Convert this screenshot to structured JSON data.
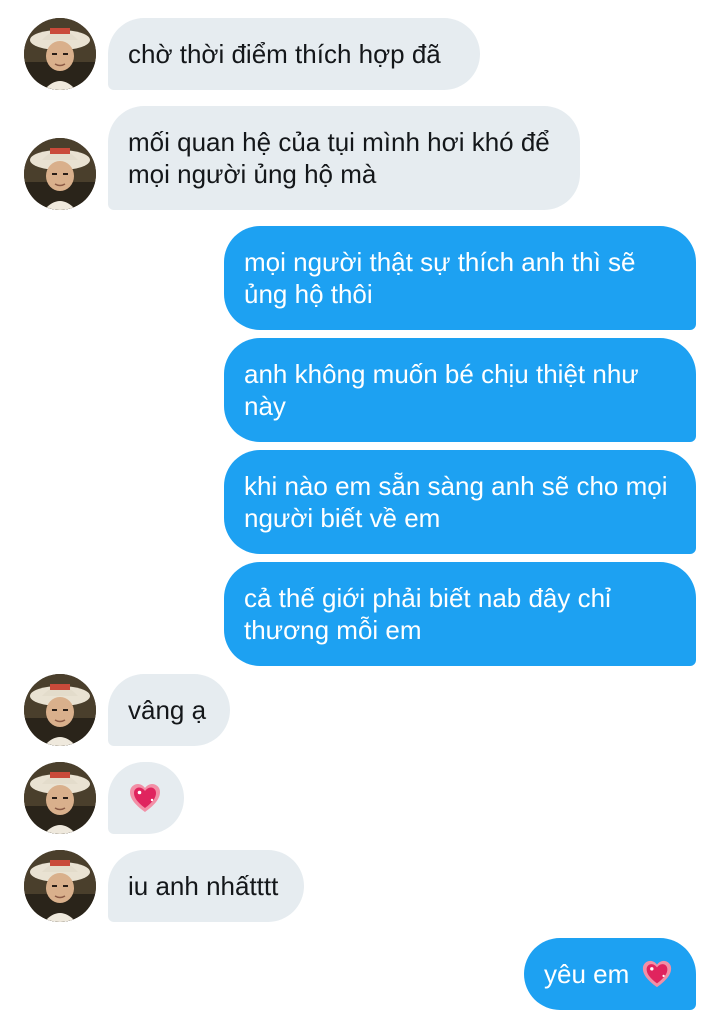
{
  "conversation": {
    "messages": [
      {
        "side": "in",
        "text": "chờ thời điểm thích hợp đã",
        "has_avatar": true
      },
      {
        "side": "in",
        "text": "mối quan hệ của tụi mình hơi khó để mọi người ủng hộ mà",
        "has_avatar": true
      },
      {
        "side": "out",
        "text": "mọi người thật sự thích anh thì sẽ ủng hộ thôi"
      },
      {
        "side": "out",
        "text": "anh không muốn bé chịu thiệt như này"
      },
      {
        "side": "out",
        "text": "khi nào em sẵn sàng anh sẽ cho mọi người biết về em"
      },
      {
        "side": "out",
        "text": "cả thế giới phải biết nab đây chỉ thương mỗi em"
      },
      {
        "side": "in",
        "text": "vâng ạ",
        "has_avatar": true
      },
      {
        "side": "in",
        "text": "",
        "emoji": "sparkling-heart-icon",
        "has_avatar": true
      },
      {
        "side": "in",
        "text": "iu anh nhấtttt",
        "has_avatar": true
      },
      {
        "side": "out",
        "text": "yêu em",
        "emoji": "sparkling-heart-icon"
      }
    ]
  },
  "colors": {
    "incoming_bubble": "#e6ecf0",
    "outgoing_bubble": "#1da1f2",
    "incoming_text": "#14171a",
    "outgoing_text": "#ffffff",
    "heart": "#e0245e"
  }
}
